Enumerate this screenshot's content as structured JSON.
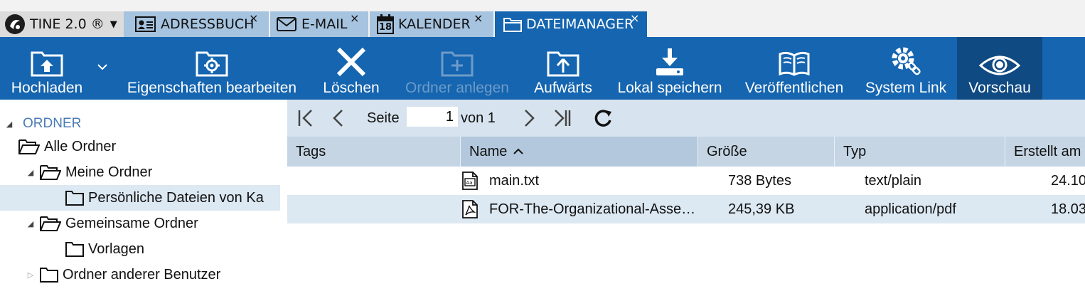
{
  "tabs": [
    {
      "label": "TINE 2.0 ®",
      "icon": "tine-logo-icon"
    },
    {
      "label": "ADRESSBUCH",
      "icon": "addressbook-icon",
      "close": "×"
    },
    {
      "label": "E-MAIL",
      "icon": "mail-icon",
      "close": "×"
    },
    {
      "label": "KALENDER",
      "icon": "calendar-icon",
      "close": "×",
      "icon_text": "18"
    },
    {
      "label": "DATEIMANAGER",
      "icon": "folder-icon",
      "close": "×",
      "active": true
    }
  ],
  "toolbar": {
    "buttons": [
      {
        "label": "Hochladen",
        "icon": "upload-icon"
      },
      {
        "label": "Eigenschaften bearbeiten",
        "icon": "folder-settings-icon"
      },
      {
        "label": "Löschen",
        "icon": "delete-x-icon"
      },
      {
        "label": "Ordner anlegen",
        "icon": "new-folder-icon",
        "disabled": true
      },
      {
        "label": "Aufwärts",
        "icon": "folder-up-icon"
      },
      {
        "label": "Lokal speichern",
        "icon": "download-icon"
      },
      {
        "label": "Veröffentlichen",
        "icon": "book-icon"
      },
      {
        "label": "System Link",
        "icon": "gear-link-icon"
      },
      {
        "label": "Vorschau",
        "icon": "eye-icon",
        "active": true
      }
    ]
  },
  "tree": {
    "root_label": "ORDNER",
    "items": [
      {
        "label": "Alle Ordner"
      },
      {
        "label": "Meine Ordner"
      },
      {
        "label": "Persönliche Dateien von Ka",
        "selected": true
      },
      {
        "label": "Gemeinsame Ordner"
      },
      {
        "label": "Vorlagen"
      },
      {
        "label": "Ordner anderer Benutzer"
      }
    ]
  },
  "pager": {
    "page_label": "Seite",
    "page_value": "1",
    "of_label": "von 1"
  },
  "grid": {
    "columns": [
      "Tags",
      "Name",
      "Größe",
      "Typ",
      "Erstellt am"
    ],
    "sorted_column": "Name",
    "rows": [
      {
        "tags": "",
        "name": "main.txt",
        "icon": "text-file-icon",
        "size": "738 Bytes",
        "type": "text/plain",
        "created": "24.10"
      },
      {
        "tags": "",
        "name": "FOR-The-Organizational-Asse…",
        "icon": "pdf-file-icon",
        "size": "245,39 KB",
        "type": "application/pdf",
        "created": "18.03"
      }
    ]
  },
  "colors": {
    "toolbar_bg": "#1565b0",
    "tab_inactive_bg": "#a6c3df",
    "pager_bg": "#d7e3ee",
    "header_bg": "#c5d5e4",
    "selected_row_bg": "#dce8f2"
  }
}
